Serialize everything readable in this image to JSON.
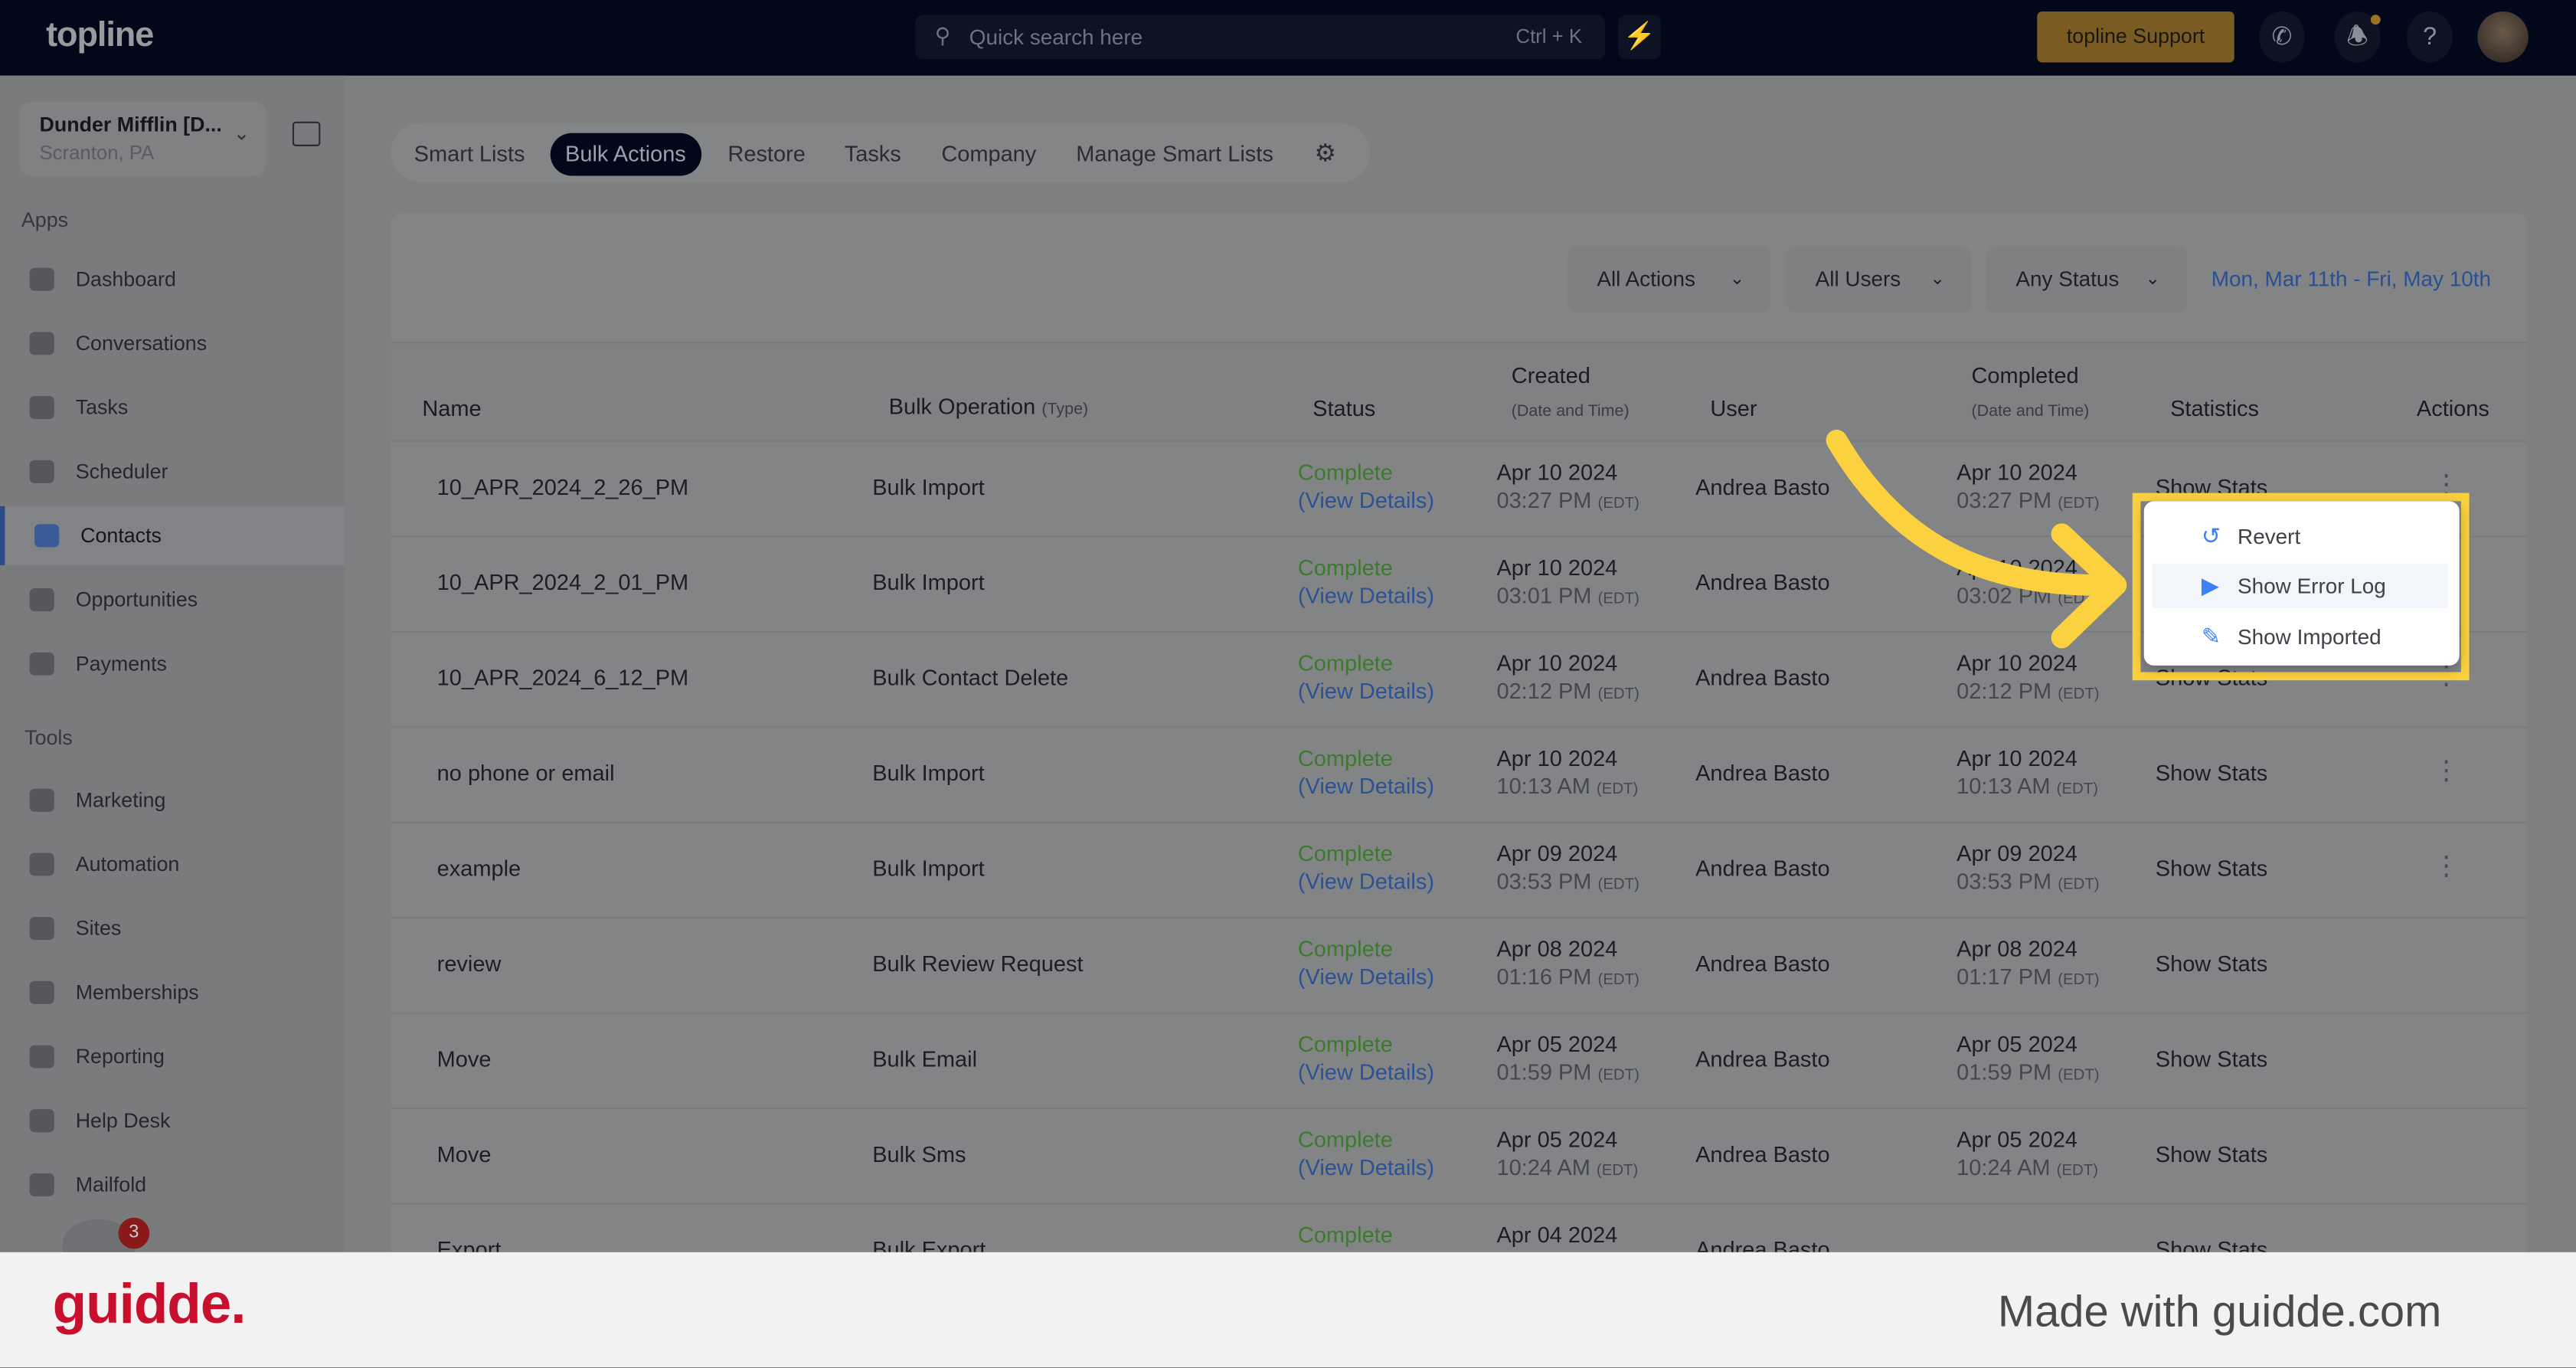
{
  "header": {
    "logo": "topline",
    "search_placeholder": "Quick search here",
    "search_shortcut": "Ctrl + K",
    "support_label": "topline Support",
    "accent": "#7a5c22"
  },
  "account": {
    "name": "Dunder Mifflin [D...",
    "location": "Scranton, PA"
  },
  "sidebar": {
    "apps_heading": "Apps",
    "tools_heading": "Tools",
    "apps": [
      {
        "label": "Dashboard"
      },
      {
        "label": "Conversations"
      },
      {
        "label": "Tasks"
      },
      {
        "label": "Scheduler"
      },
      {
        "label": "Contacts",
        "active": true
      },
      {
        "label": "Opportunities"
      },
      {
        "label": "Payments"
      }
    ],
    "tools": [
      {
        "label": "Marketing"
      },
      {
        "label": "Automation"
      },
      {
        "label": "Sites"
      },
      {
        "label": "Memberships"
      },
      {
        "label": "Reporting"
      },
      {
        "label": "Help Desk"
      },
      {
        "label": "Mailfold"
      }
    ],
    "badge_count": "3"
  },
  "tabs": [
    {
      "label": "Smart Lists"
    },
    {
      "label": "Bulk Actions",
      "active": true
    },
    {
      "label": "Restore"
    },
    {
      "label": "Tasks"
    },
    {
      "label": "Company"
    },
    {
      "label": "Manage Smart Lists"
    }
  ],
  "filters": {
    "actions": "All Actions",
    "users": "All Users",
    "status": "Any Status",
    "date_range": "Mon, Mar 11th - Fri, May 10th"
  },
  "table": {
    "headers": {
      "name": "Name",
      "op": "Bulk Operation",
      "op_sub": "(Type)",
      "status": "Status",
      "created": "Created",
      "created_sub": "(Date and Time)",
      "user": "User",
      "completed": "Completed",
      "completed_sub": "(Date and Time)",
      "stats": "Statistics",
      "actions": "Actions"
    },
    "tz": "(EDT)",
    "view_details": "(View Details)",
    "show_stats": "Show Stats",
    "rows": [
      {
        "name": "10_APR_2024_2_26_PM",
        "op": "Bulk Import",
        "status": "Complete",
        "c_date": "Apr 10 2024",
        "c_time": "03:27 PM",
        "d_date": "Apr 10 2024",
        "d_time": "03:27 PM"
      },
      {
        "name": "10_APR_2024_2_01_PM",
        "op": "Bulk Import",
        "status": "Complete",
        "c_date": "Apr 10 2024",
        "c_time": "03:01 PM",
        "d_date": "Apr 10 2024",
        "d_time": "03:02 PM"
      },
      {
        "name": "10_APR_2024_6_12_PM",
        "op": "Bulk Contact Delete",
        "status": "Complete",
        "c_date": "Apr 10 2024",
        "c_time": "02:12 PM",
        "d_date": "Apr 10 2024",
        "d_time": "02:12 PM"
      },
      {
        "name": "no phone or email",
        "op": "Bulk Import",
        "status": "Complete",
        "c_date": "Apr 10 2024",
        "c_time": "10:13 AM",
        "d_date": "Apr 10 2024",
        "d_time": "10:13 AM"
      },
      {
        "name": "example",
        "op": "Bulk Import",
        "status": "Complete",
        "c_date": "Apr 09 2024",
        "c_time": "03:53 PM",
        "d_date": "Apr 09 2024",
        "d_time": "03:53 PM"
      },
      {
        "name": "review",
        "op": "Bulk Review Request",
        "status": "Complete",
        "c_date": "Apr 08 2024",
        "c_time": "01:16 PM",
        "d_date": "Apr 08 2024",
        "d_time": "01:17 PM"
      },
      {
        "name": "Move",
        "op": "Bulk Email",
        "status": "Complete",
        "c_date": "Apr 05 2024",
        "c_time": "01:59 PM",
        "d_date": "Apr 05 2024",
        "d_time": "01:59 PM"
      },
      {
        "name": "Move",
        "op": "Bulk Sms",
        "status": "Complete",
        "c_date": "Apr 05 2024",
        "c_time": "10:24 AM",
        "d_date": "Apr 05 2024",
        "d_time": "10:24 AM"
      },
      {
        "name": "Export",
        "op": "Bulk Export",
        "status": "Complete",
        "c_date": "Apr 04 2024",
        "c_time": "",
        "d_date": "",
        "d_time": ""
      }
    ],
    "user": "Andrea Basto"
  },
  "menu": {
    "items": [
      {
        "label": "Revert",
        "icon": "undo-icon"
      },
      {
        "label": "Show Error Log",
        "icon": "play-icon",
        "hover": true
      },
      {
        "label": "Show Imported",
        "icon": "edit-icon"
      }
    ],
    "highlight_color": "#fcd140"
  },
  "footer": {
    "brand": "guidde.",
    "credit": "Made with guidde.com"
  }
}
